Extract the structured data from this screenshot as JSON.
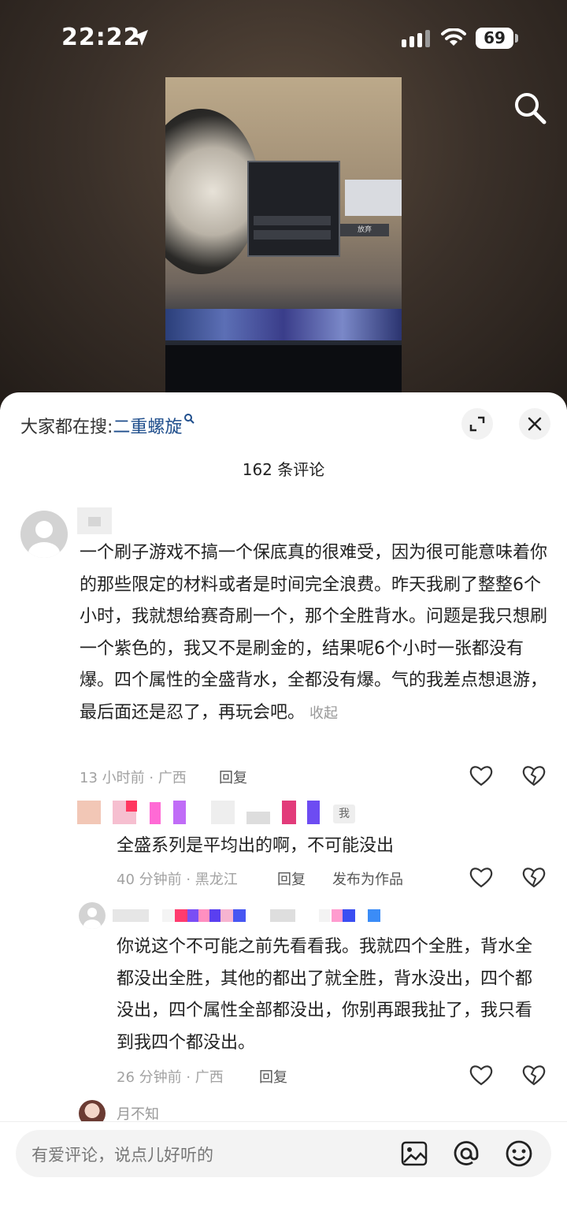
{
  "status": {
    "time": "22:22",
    "battery": "69"
  },
  "hot_search": {
    "prefix": "大家都在搜:",
    "keyword": "二重螺旋"
  },
  "comments_count": "162 条评论",
  "game": {
    "button": "放弃"
  },
  "comments": [
    {
      "text": "一个刷子游戏不搞一个保底真的很难受，因为很可能意味着你的那些限定的材料或者是时间完全浪费。昨天我刷了整整6个小时，我就想给赛奇刷一个，那个全胜背水。问题是我只想刷一个紫色的，我又不是刷金的，结果呢6个小时一张都没有爆。四个属性的全盛背水，全都没有爆。气的我差点想退游，最后面还是忍了，再玩会吧。",
      "collapse": "收起",
      "meta": "13 小时前 · 广西",
      "reply": "回复"
    }
  ],
  "replies": [
    {
      "tag": "我",
      "text": "全盛系列是平均出的啊，不可能没出",
      "meta": "40 分钟前 · 黑龙江",
      "reply": "回复",
      "publish": "发布为作品"
    },
    {
      "text": "你说这个不可能之前先看看我。我就四个全胜，背水全都没出全胜，其他的都出了就全胜，背水没出，四个都没出，四个属性全部都没出，你别再跟我扯了，我只看到我四个都没出。",
      "meta": "26 分钟前 · 广西",
      "reply": "回复"
    },
    {
      "name": "月不知"
    }
  ],
  "input": {
    "placeholder": "有爱评论，说点儿好听的"
  },
  "icons": [
    "location-arrow-icon",
    "signal-icon",
    "wifi-icon",
    "search-icon",
    "expand-icon",
    "close-icon",
    "heart-icon",
    "dislike-heart-icon",
    "image-icon",
    "at-icon",
    "emoji-icon"
  ]
}
